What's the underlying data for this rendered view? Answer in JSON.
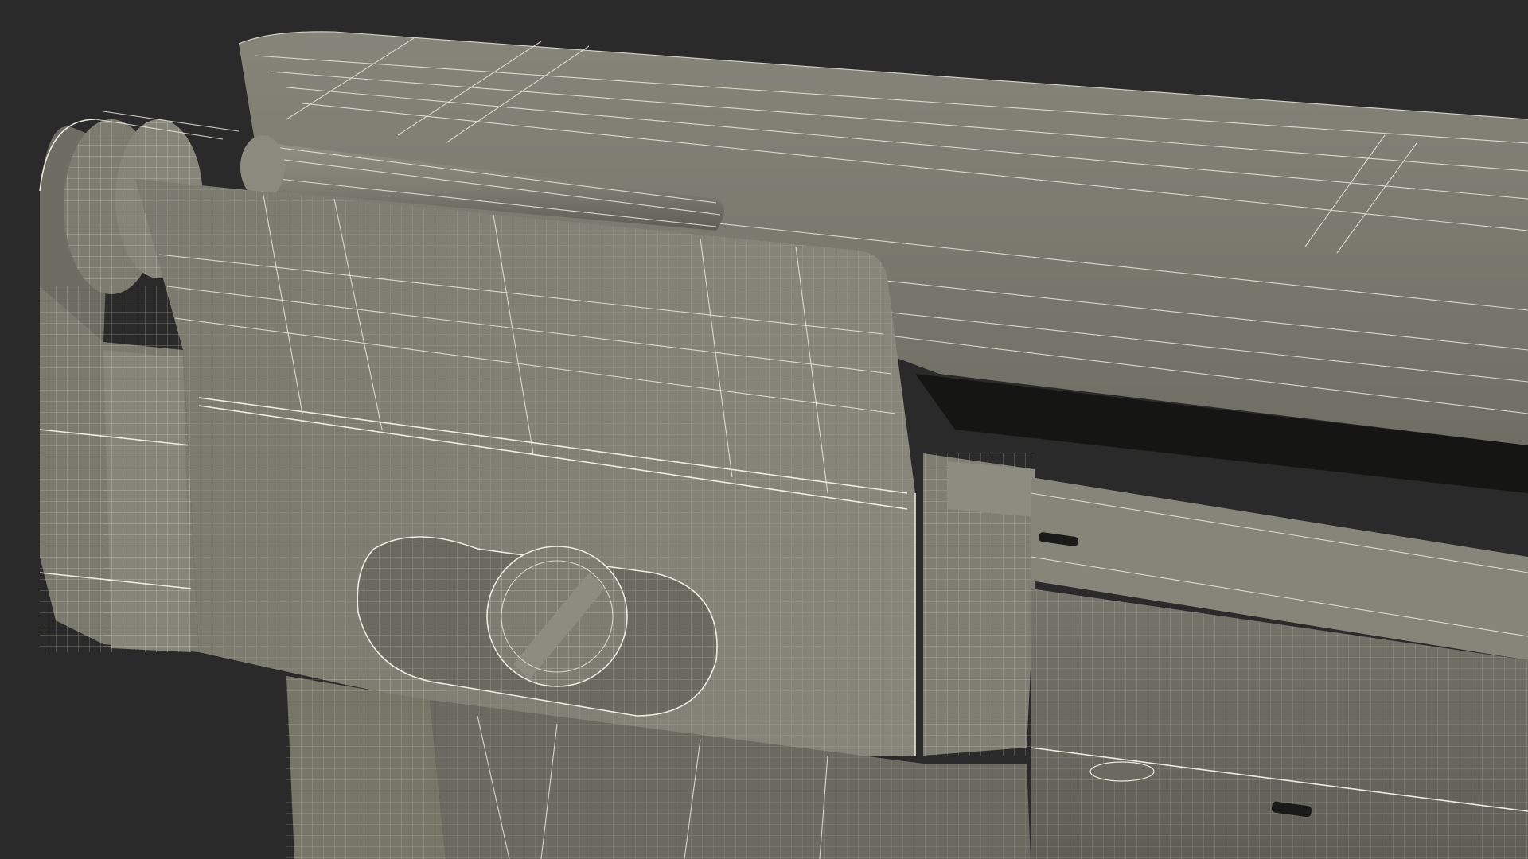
{
  "scene": {
    "subject": "",
    "render_style": "wireframe-over-shaded"
  },
  "colors": {
    "background": "#2a2a2a",
    "surface_light": "#8a8a7e",
    "surface_mid": "#7b7b70",
    "surface_dark": "#5f5f56",
    "shadow": "#161614",
    "wire": "#e9e8dc"
  }
}
